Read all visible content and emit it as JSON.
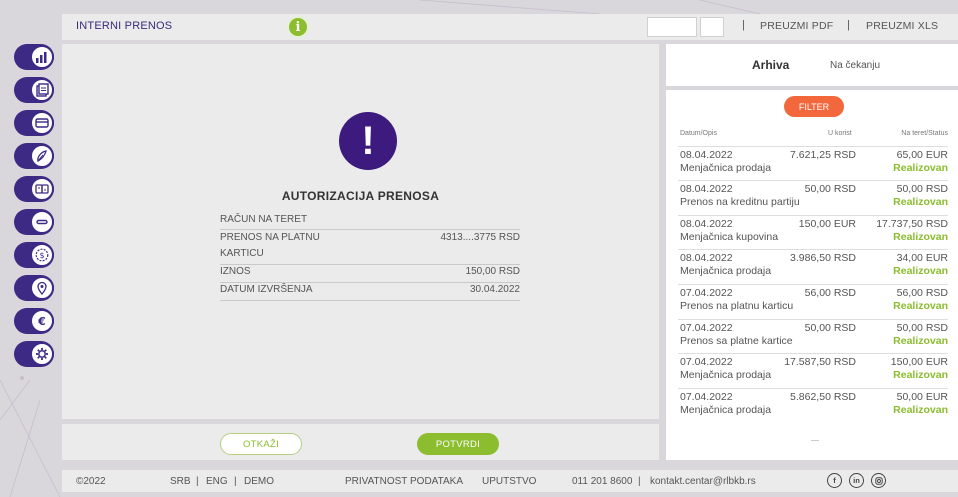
{
  "header": {
    "title": "INTERNI PRENOS",
    "download_pdf": "PREUZMI PDF",
    "download_xls": "PREUZMI XLS",
    "separator": "|"
  },
  "sidebar": {
    "items": [
      {
        "icon": "bar-chart-icon"
      },
      {
        "icon": "document-icon"
      },
      {
        "icon": "card-icon"
      },
      {
        "icon": "pen-icon"
      },
      {
        "icon": "transfer-icon"
      },
      {
        "icon": "minus-icon"
      },
      {
        "icon": "dollar-icon"
      },
      {
        "icon": "location-pin-icon"
      },
      {
        "icon": "euro-icon"
      },
      {
        "icon": "settings-icon"
      }
    ]
  },
  "main": {
    "title": "AUTORIZACIJA PRENOSA",
    "details": [
      {
        "label": "RAČUN NA TERET",
        "value": ""
      },
      {
        "label": "PRENOS NA PLATNU",
        "value": "4313....3775 RSD"
      },
      {
        "label": "KARTICU",
        "value": ""
      },
      {
        "label": "IZNOS",
        "value": "150,00 RSD"
      },
      {
        "label": "DATUM IZVRŠENJA",
        "value": "30.04.2022"
      }
    ],
    "cancel_label": "OTKAŽI",
    "confirm_label": "POTVRDI"
  },
  "archive": {
    "tab_archive": "Arhiva",
    "tab_pending": "Na čekanju",
    "filter_label": "FILTER",
    "col_date": "Datum/Opis",
    "col_credit": "U korist",
    "col_debit": "Na teret/Status",
    "transactions": [
      {
        "date": "08.04.2022",
        "desc": "Menjačnica prodaja",
        "amount": "7.621,25 RSD",
        "charge": "65,00 EUR",
        "status": "Realizovan"
      },
      {
        "date": "08.04.2022",
        "desc": "Prenos na kreditnu partiju",
        "amount": "50,00 RSD",
        "charge": "50,00 RSD",
        "status": "Realizovan"
      },
      {
        "date": "08.04.2022",
        "desc": "Menjačnica kupovina",
        "amount": "150,00 EUR",
        "charge": "17.737,50 RSD",
        "status": "Realizovan"
      },
      {
        "date": "08.04.2022",
        "desc": "Menjačnica prodaja",
        "amount": "3.986,50 RSD",
        "charge": "34,00 EUR",
        "status": "Realizovan"
      },
      {
        "date": "07.04.2022",
        "desc": "Prenos na platnu karticu",
        "amount": "56,00 RSD",
        "charge": "56,00 RSD",
        "status": "Realizovan"
      },
      {
        "date": "07.04.2022",
        "desc": "Prenos sa platne kartice",
        "amount": "50,00 RSD",
        "charge": "50,00 RSD",
        "status": "Realizovan"
      },
      {
        "date": "07.04.2022",
        "desc": "Menjačnica prodaja",
        "amount": "17.587,50 RSD",
        "charge": "150,00 EUR",
        "status": "Realizovan"
      },
      {
        "date": "07.04.2022",
        "desc": "Menjačnica prodaja",
        "amount": "5.862,50 RSD",
        "charge": "50,00 EUR",
        "status": "Realizovan"
      }
    ]
  },
  "footer": {
    "copyright": "©2022",
    "lang_srb": "SRB",
    "lang_eng": "ENG",
    "demo": "DEMO",
    "privacy": "PRIVATNOST PODATAKA",
    "instructions": "UPUTSTVO",
    "phone": "011 201 8600",
    "email": "kontakt.centar@rlbkb.rs",
    "sep": "|"
  },
  "colors": {
    "brand_purple": "#3d2a85",
    "accent_green": "#8bbd2f",
    "filter_orange": "#f2683c"
  }
}
